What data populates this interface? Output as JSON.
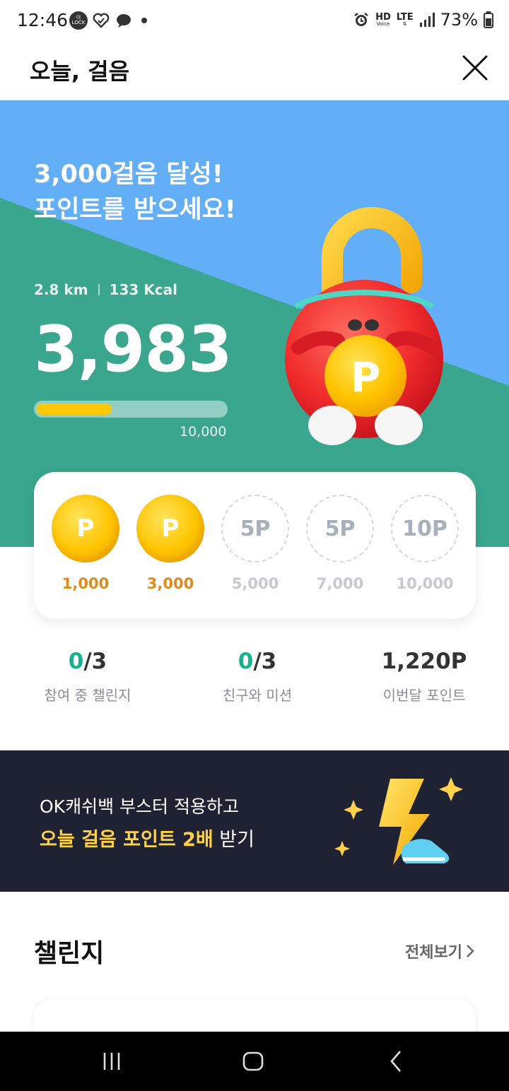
{
  "status_bar": {
    "time": "12:46",
    "lock_badge": "이\nLOCK",
    "battery": "73%",
    "hd_label": "HD",
    "hd_sub": "Voice",
    "lte_label": "LTE"
  },
  "header": {
    "title": "오늘, 걸음"
  },
  "hero": {
    "headline_line1": "3,000걸음 달성!",
    "headline_line2": "포인트를 받으세요!",
    "distance": "2.8 km",
    "calories": "133 Kcal",
    "steps": "3,983",
    "goal": "10,000",
    "progress_fraction": 0.398,
    "mascot_coin_letter": "P",
    "colors": {
      "sky": "#62aef7",
      "teal": "#3aa68e",
      "progress": "#ffc800"
    }
  },
  "rewards": [
    {
      "icon_text": "P",
      "label": "1,000",
      "claimed": true
    },
    {
      "icon_text": "P",
      "label": "3,000",
      "claimed": true
    },
    {
      "icon_text": "5P",
      "label": "5,000",
      "claimed": false
    },
    {
      "icon_text": "5P",
      "label": "7,000",
      "claimed": false
    },
    {
      "icon_text": "10P",
      "label": "10,000",
      "claimed": false
    }
  ],
  "summary": {
    "challenges": {
      "done": "0",
      "total": "/3",
      "label": "참여 중 챌린지"
    },
    "friends": {
      "done": "0",
      "total": "/3",
      "label": "친구와 미션"
    },
    "points": {
      "value": "1,220P",
      "label": "이번달 포인트"
    }
  },
  "banner": {
    "line1": "OK캐쉬백 부스터 적용하고",
    "line2_highlight": "오늘 걸음 포인트 2배",
    "line2_rest": " 받기",
    "bg_color": "#1f2233"
  },
  "challenge_section": {
    "title": "챌린지",
    "see_all": "전체보기"
  }
}
